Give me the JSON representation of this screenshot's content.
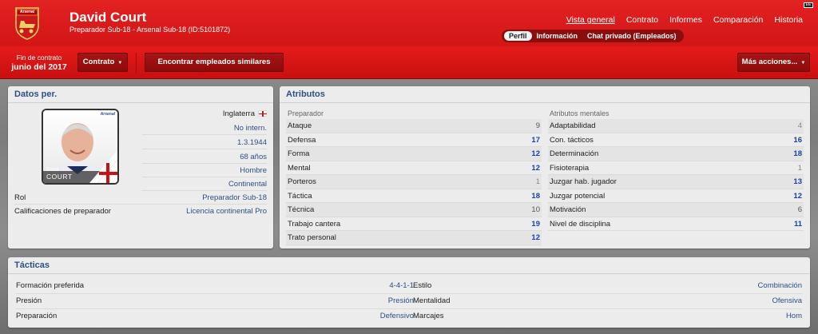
{
  "header": {
    "club_crest_text": "Arsenal",
    "player_name": "David Court",
    "subtitle": "Preparador Sub-18 - Arsenal Sub-18 (ID:5101872)",
    "nav": [
      "Vista general",
      "Contrato",
      "Informes",
      "Comparación",
      "Historia"
    ],
    "subnav": [
      "Perfil",
      "Información",
      "Chat privado (Empleados)"
    ],
    "corner_badge": "EE"
  },
  "toolbar": {
    "contract_label": "Fin de contrato",
    "contract_value": "junio del 2017",
    "contract_button": "Contrato",
    "similar_button": "Encontrar empleados similares",
    "more_button": "Más acciones..."
  },
  "personal": {
    "title": "Datos per.",
    "photo_first_name": "David",
    "photo_last_name": "COURT",
    "sponsor_text": "Arsenal",
    "values": [
      "Inglaterra",
      "No intern.",
      "1.3.1944",
      "68 años",
      "Hombre",
      "Continental"
    ],
    "rows": [
      {
        "label": "Rol",
        "value": "Preparador Sub-18"
      },
      {
        "label": "Calificaciones de preparador",
        "value": "Licencia continental Pro"
      }
    ]
  },
  "attributes": {
    "title": "Atributos",
    "left_heading": "Preparador",
    "right_heading": "Atributos mentales",
    "left": [
      {
        "label": "Ataque",
        "value": "9",
        "tier": "mid"
      },
      {
        "label": "Defensa",
        "value": "17",
        "tier": "hi"
      },
      {
        "label": "Forma",
        "value": "12",
        "tier": "hi"
      },
      {
        "label": "Mental",
        "value": "12",
        "tier": "hi"
      },
      {
        "label": "Porteros",
        "value": "1",
        "tier": "lo"
      },
      {
        "label": "Táctica",
        "value": "18",
        "tier": "hi"
      },
      {
        "label": "Técnica",
        "value": "10",
        "tier": "mid"
      },
      {
        "label": "Trabajo cantera",
        "value": "19",
        "tier": "hi"
      },
      {
        "label": "Trato personal",
        "value": "12",
        "tier": "hi"
      }
    ],
    "right": [
      {
        "label": "Adaptabilidad",
        "value": "4",
        "tier": "lo"
      },
      {
        "label": "Con. tácticos",
        "value": "16",
        "tier": "hi"
      },
      {
        "label": "Determinación",
        "value": "18",
        "tier": "hi"
      },
      {
        "label": "Fisioterapia",
        "value": "1",
        "tier": "lo"
      },
      {
        "label": "Juzgar hab. jugador",
        "value": "13",
        "tier": "hi"
      },
      {
        "label": "Juzgar potencial",
        "value": "12",
        "tier": "hi"
      },
      {
        "label": "Motivación",
        "value": "6",
        "tier": "mid"
      },
      {
        "label": "Nivel de disciplina",
        "value": "11",
        "tier": "hi"
      }
    ]
  },
  "tactics": {
    "title": "Tácticas",
    "left": [
      {
        "label": "Formación preferida",
        "value": "4-4-1-1"
      },
      {
        "label": "Presión",
        "value": "Presión"
      },
      {
        "label": "Preparación",
        "value": "Defensivo"
      }
    ],
    "right": [
      {
        "label": "Estilo",
        "value": "Combinación"
      },
      {
        "label": "Mentalidad",
        "value": "Ofensiva"
      },
      {
        "label": "Marcajes",
        "value": "Hom"
      }
    ]
  },
  "colors": {
    "header_red": "#e32222",
    "link_blue": "#2f4f84",
    "high_value_blue": "#1b3fb0"
  }
}
